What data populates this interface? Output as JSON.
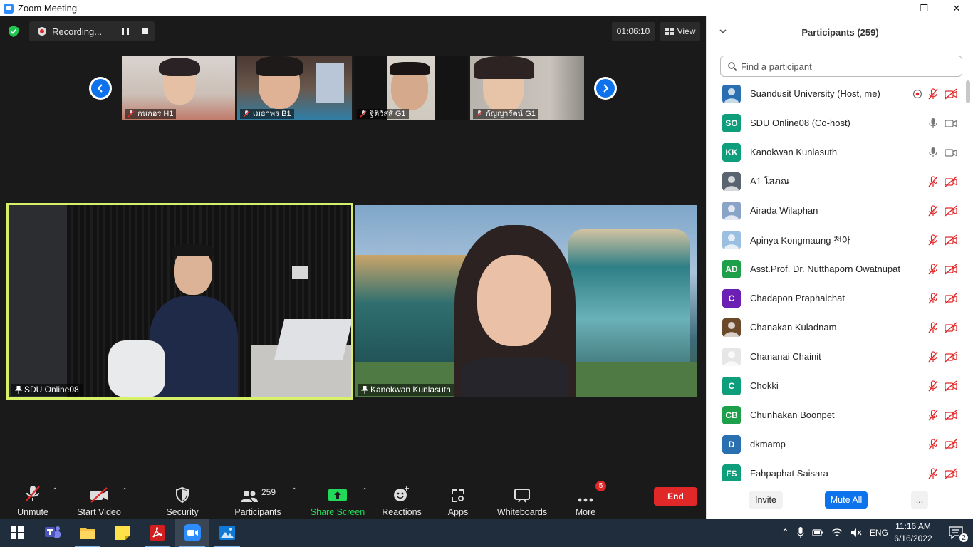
{
  "window": {
    "title": "Zoom Meeting",
    "minimize": "—",
    "maximize": "❐",
    "close": "✕"
  },
  "meeting_bar": {
    "recording_label": "Recording...",
    "elapsed_time": "01:06:10",
    "view_label": "View"
  },
  "gallery": {
    "thumbnails": [
      {
        "name": "กนกอร H1"
      },
      {
        "name": "เมธาพร B1"
      },
      {
        "name": "ฐิติวัสส์ G1"
      },
      {
        "name": "กัญญารัตน์ G1"
      }
    ],
    "speakers": [
      {
        "name": "SDU Online08"
      },
      {
        "name": "Kanokwan Kunlasuth"
      }
    ]
  },
  "toolbar": {
    "unmute": "Unmute",
    "start_video": "Start Video",
    "security": "Security",
    "participants": "Participants",
    "participants_count": "259",
    "share_screen": "Share Screen",
    "reactions": "Reactions",
    "apps": "Apps",
    "whiteboards": "Whiteboards",
    "more": "More",
    "more_badge": "5",
    "end": "End"
  },
  "panel": {
    "title": "Participants (259)",
    "search_placeholder": "Find a participant",
    "participants": [
      {
        "name": "Suandusit University (Host, me)",
        "initials": "",
        "avatar_color": "#2a6fb0",
        "audio": "muted",
        "video": "off",
        "recording": true
      },
      {
        "name": "SDU Online08 (Co-host)",
        "initials": "SO",
        "avatar_color": "#0e9e7c",
        "audio": "on",
        "video": "on"
      },
      {
        "name": "Kanokwan Kunlasuth",
        "initials": "KK",
        "avatar_color": "#0e9e7c",
        "audio": "on",
        "video": "on"
      },
      {
        "name": "A1 โสภณ",
        "initials": "",
        "avatar_color": "#5a6470",
        "audio": "muted",
        "video": "off"
      },
      {
        "name": "Airada Wilaphan",
        "initials": "",
        "avatar_color": "#8aa4c8",
        "audio": "muted",
        "video": "off"
      },
      {
        "name": "Apinya Kongmaung 천아",
        "initials": "",
        "avatar_color": "#9bbfe0",
        "audio": "muted",
        "video": "off"
      },
      {
        "name": "Asst.Prof. Dr. Nutthaporn Owatnupat",
        "initials": "AD",
        "avatar_color": "#1ea04a",
        "audio": "muted",
        "video": "off"
      },
      {
        "name": "Chadapon Praphaichat",
        "initials": "C",
        "avatar_color": "#6c1fb3",
        "audio": "muted",
        "video": "off"
      },
      {
        "name": "Chanakan Kuladnam",
        "initials": "",
        "avatar_color": "#6a4a2a",
        "audio": "muted",
        "video": "off"
      },
      {
        "name": "Chananai Chainit",
        "initials": "",
        "avatar_color": "#e6e6e6",
        "audio": "muted",
        "video": "off"
      },
      {
        "name": "Chokki",
        "initials": "C",
        "avatar_color": "#0e9e7c",
        "audio": "muted",
        "video": "off"
      },
      {
        "name": "Chunhakan Boonpet",
        "initials": "CB",
        "avatar_color": "#1ea04a",
        "audio": "muted",
        "video": "off"
      },
      {
        "name": "dkmamp",
        "initials": "D",
        "avatar_color": "#2a6fb0",
        "audio": "muted",
        "video": "off"
      },
      {
        "name": "Fahpaphat Saisara",
        "initials": "FS",
        "avatar_color": "#0e9e7c",
        "audio": "muted",
        "video": "off"
      }
    ],
    "invite": "Invite",
    "mute_all": "Mute All",
    "more": "..."
  },
  "taskbar": {
    "language": "ENG",
    "time": "11:16 AM",
    "date": "6/16/2022",
    "notifications": "2"
  },
  "colors": {
    "zoom_blue": "#0e72ed",
    "end_red": "#e02828",
    "share_green": "#23d959",
    "active_speaker_border": "#d6f06a"
  }
}
